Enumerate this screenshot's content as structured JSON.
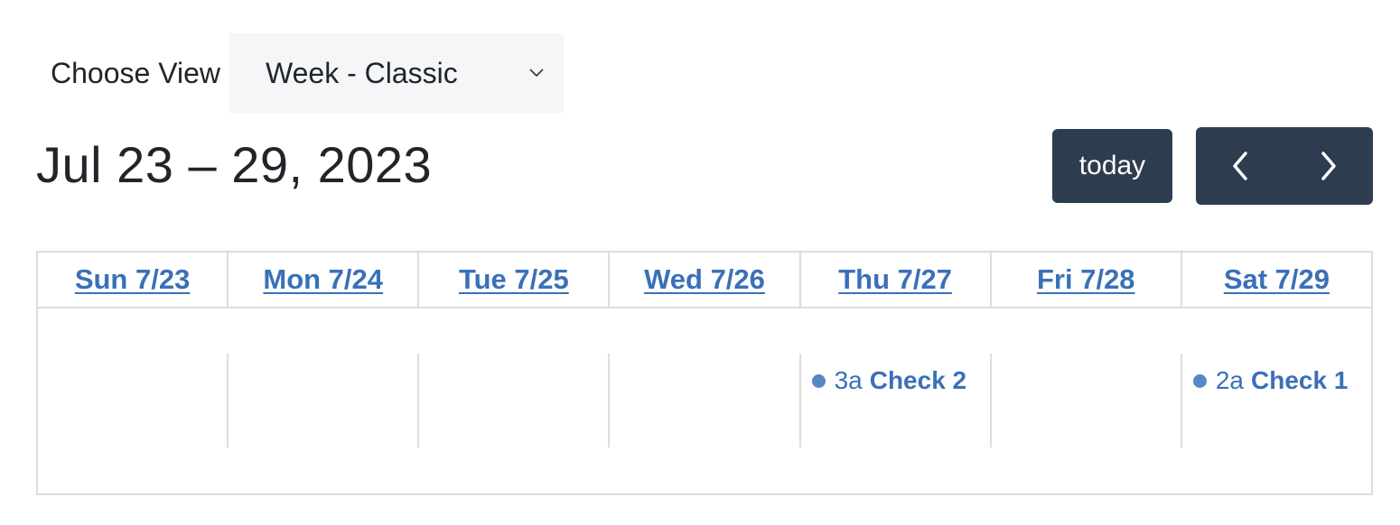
{
  "view_chooser": {
    "label": "Choose View",
    "selected": "Week - Classic"
  },
  "toolbar": {
    "title": "Jul 23 – 29, 2023",
    "today_label": "today",
    "prev_icon": "chevron-left-icon",
    "next_icon": "chevron-right-icon",
    "button_color": "#2e3c50"
  },
  "calendar": {
    "link_color": "#3a70b8",
    "days": [
      {
        "label": "Sun 7/23",
        "events": []
      },
      {
        "label": "Mon 7/24",
        "events": []
      },
      {
        "label": "Tue 7/25",
        "events": []
      },
      {
        "label": "Wed 7/26",
        "events": []
      },
      {
        "label": "Thu 7/27",
        "events": [
          {
            "time": "3a",
            "title": "Check 2",
            "dot_color": "#5886c7"
          }
        ]
      },
      {
        "label": "Fri 7/28",
        "events": []
      },
      {
        "label": "Sat 7/29",
        "events": [
          {
            "time": "2a",
            "title": "Check 1",
            "dot_color": "#5886c7"
          }
        ]
      }
    ]
  }
}
